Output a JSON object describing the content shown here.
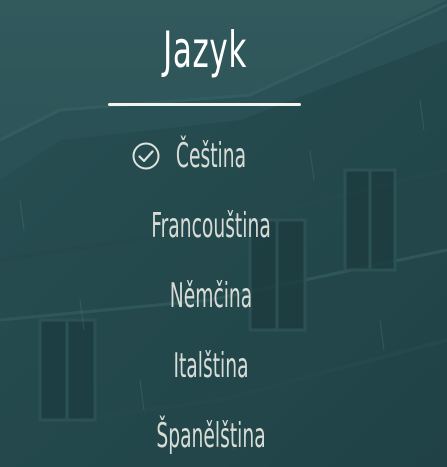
{
  "screen": {
    "title": "Jazyk"
  },
  "languages": [
    {
      "label": "Čeština",
      "selected": true
    },
    {
      "label": "Francouština",
      "selected": false
    },
    {
      "label": "Němčina",
      "selected": false
    },
    {
      "label": "Italština",
      "selected": false
    },
    {
      "label": "Španělština",
      "selected": false
    }
  ],
  "colors": {
    "background": "#2c5559",
    "text": "#d8dcd6",
    "title": "#ffffff"
  },
  "icons": {
    "selected_marker": "check-circle-icon"
  }
}
